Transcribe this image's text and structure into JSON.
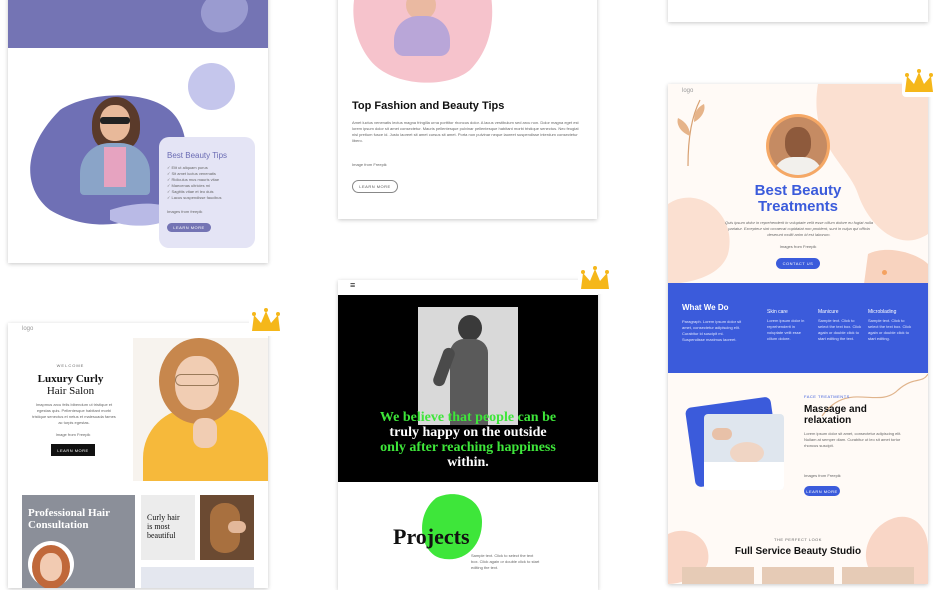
{
  "card_a": {
    "heading": "Best Beauty Tips",
    "items": [
      "Elit ut aliquam purus",
      "Sit amet luctus venenatis",
      "Ridiculus mus mauris vitae",
      "Maecenas ultricies mi",
      "Sagittis vitae et leo duis",
      "Lacus suspendisse faucibus"
    ],
    "image_from": "Images from freepik",
    "button": "LEARN MORE"
  },
  "card_b": {
    "heading": "Top Fashion and Beauty Tips",
    "body": "Amet luctus venenatis lectus magna fringilla urna porttitor rhoncus dolor. A lacus vestibulum sed arcu non. Dolor magna eget est lorem ipsum dolor sit amet consectetur. Mauris pellentesque pulvinar pellentesque habitant morbi tristique senectus. Nec feugiat nisl pretium fusce id. Justo laoreet sit amet cursus sit amet. Porta non pulvinar neque laoreet suspendisse interdum consectetur libero.",
    "image_from": "Image from Freepik",
    "button": "LEARN MORE"
  },
  "card_c": {
    "logo": "logo",
    "title_line1": "Best Beauty",
    "title_line2": "Treatments",
    "intro": "Quis ipsum dolor in reprehenderit in voluptate velit esse cillum dolore eu fugiat nulla pariatur. Excepteur sint occaecat cupidatat non proident, sunt in culpa qui officia deserunt mollit anim id est laborum.",
    "image_from": "Images from Freepik",
    "button": "CONTACT US",
    "what_we_do": "What We Do",
    "what_text": "Paragraph. Lorem ipsum dolor sit amet, consectetur adipiscing elit. Curabitur id suscipit mi. Suspendisse maximus laoreet.",
    "services": [
      {
        "name": "Skin care",
        "text": "Lorem ipsum dolor in reprehenderit in voluptate velit esse cillum dolore."
      },
      {
        "name": "Manicure",
        "text": "Sample text. Click to select the text box. Click again or double click to start editing the text."
      },
      {
        "name": "Microblading",
        "text": "Sample text. Click to select the text box. Click again or double click to start editing."
      }
    ],
    "face_label": "FACE TREATMENTS",
    "massage_line1": "Massage and",
    "massage_line2": "relaxation",
    "massage_text": "Lorem ipsum dolor sit amet, consectetur adipiscing elit. Nullam at semper diam. Curabitur ut leo sit amet tortor rhoncus suscipit.",
    "massage_from": "Images from Freepik",
    "massage_button": "LEARN MORE",
    "perfect_label": "THE PERFECT LOOK",
    "studio_title": "Full Service Beauty Studio"
  },
  "card_d": {
    "logo": "logo",
    "welcome": "WELCOME",
    "title_line1": "Luxury Curly",
    "title_line2": "Hair Salon",
    "body": "Imapmus arcu felis bibendum ut tristique et egestas quis. Pellentesque habitant morbi tristique senectus et netus et malesuada fames ac turpis egestas.",
    "image_from": "Image from Freepik",
    "button": "LEARN MORE",
    "consult_line1": "Professional Hair",
    "consult_line2": "Consultation",
    "curly_line1": "Curly hair",
    "curly_line2": "is most",
    "curly_line3": "beautiful"
  },
  "card_e": {
    "menu_icon": "≡",
    "headline_line1": "We believe that people can be",
    "headline_line2": "truly happy on the outside",
    "headline_line3": "only after reaching happiness",
    "headline_line4": "within.",
    "projects": "Projects",
    "sample": "Sample text. Click to select the text box. Click again or double click to start editing the text."
  },
  "colors": {
    "periwinkle": "#7474b4",
    "lilac": "#c3c4ec",
    "royal_blue": "#3b5bdb",
    "coral": "#f9d2c4",
    "gold": "#f5b71a",
    "green": "#3ee63a",
    "black": "#000000"
  }
}
